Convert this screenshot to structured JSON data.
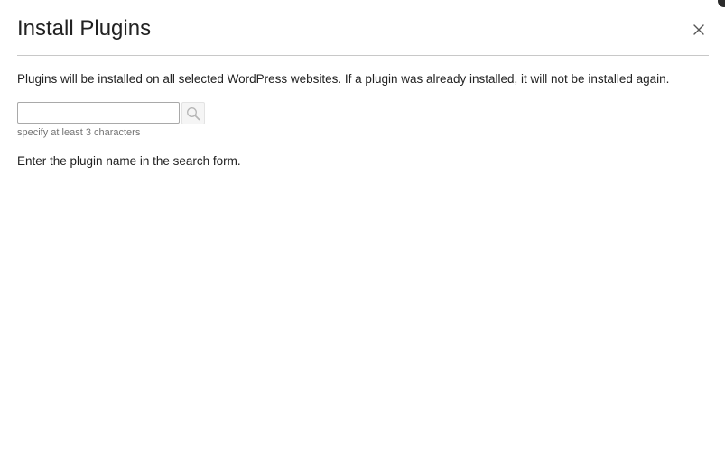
{
  "dialog": {
    "title": "Install Plugins",
    "close_icon": "close-icon",
    "description": "Plugins will be installed on all selected WordPress websites. If a plugin was already installed, it will not be installed again."
  },
  "search": {
    "value": "",
    "placeholder": "",
    "button_icon": "search-icon",
    "hint": "specify at least 3 characters"
  },
  "results": {
    "empty_message": "Enter the plugin name in the search form."
  },
  "colors": {
    "text": "#222222",
    "hint_text": "#737373",
    "divider": "#c8c8c8",
    "input_border": "#a9a9a9",
    "button_bg": "#f5f5f5"
  }
}
